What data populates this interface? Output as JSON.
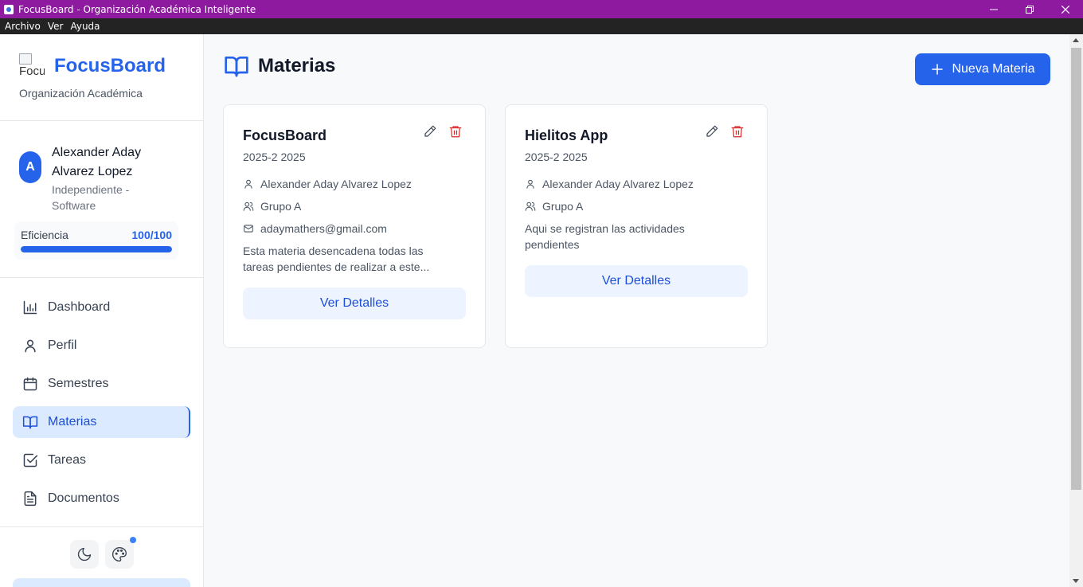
{
  "window": {
    "title": "FocusBoard - Organización Académica Inteligente"
  },
  "menu": {
    "items": [
      "Archivo",
      "Ver",
      "Ayuda"
    ]
  },
  "sidebar": {
    "logo_alt": "Focu",
    "brand_name": "FocusBoard",
    "brand_subtitle": "Organización Académica",
    "user": {
      "initial": "A",
      "name": "Alexander Aday Alvarez Lopez",
      "role": "Independiente - Software"
    },
    "efficiency": {
      "label": "Eficiencia",
      "value_text": "100/100",
      "percent": 100
    },
    "nav": [
      {
        "label": "Dashboard",
        "icon": "bar-chart-icon",
        "active": false
      },
      {
        "label": "Perfil",
        "icon": "user-icon",
        "active": false
      },
      {
        "label": "Semestres",
        "icon": "calendar-icon",
        "active": false
      },
      {
        "label": "Materias",
        "icon": "book-open-icon",
        "active": true
      },
      {
        "label": "Tareas",
        "icon": "check-square-icon",
        "active": false
      },
      {
        "label": "Documentos",
        "icon": "file-text-icon",
        "active": false
      }
    ]
  },
  "main": {
    "title": "Materias",
    "new_button_label": "Nueva Materia",
    "cards": [
      {
        "title": "FocusBoard",
        "period": "2025-2 2025",
        "professor": "Alexander Aday Alvarez Lopez",
        "group": "Grupo A",
        "email": "adaymathers@gmail.com",
        "description": "Esta materia desencadena todas las tareas pendientes de realizar a este...",
        "button_label": "Ver Detalles"
      },
      {
        "title": "Hielitos App",
        "period": "2025-2 2025",
        "professor": "Alexander Aday Alvarez Lopez",
        "group": "Grupo A",
        "description": "Aqui se registran las actividades pendientes",
        "button_label": "Ver Detalles"
      }
    ]
  },
  "colors": {
    "titlebar": "#8e1aa0",
    "accent": "#2563eb",
    "danger": "#dc2626"
  }
}
